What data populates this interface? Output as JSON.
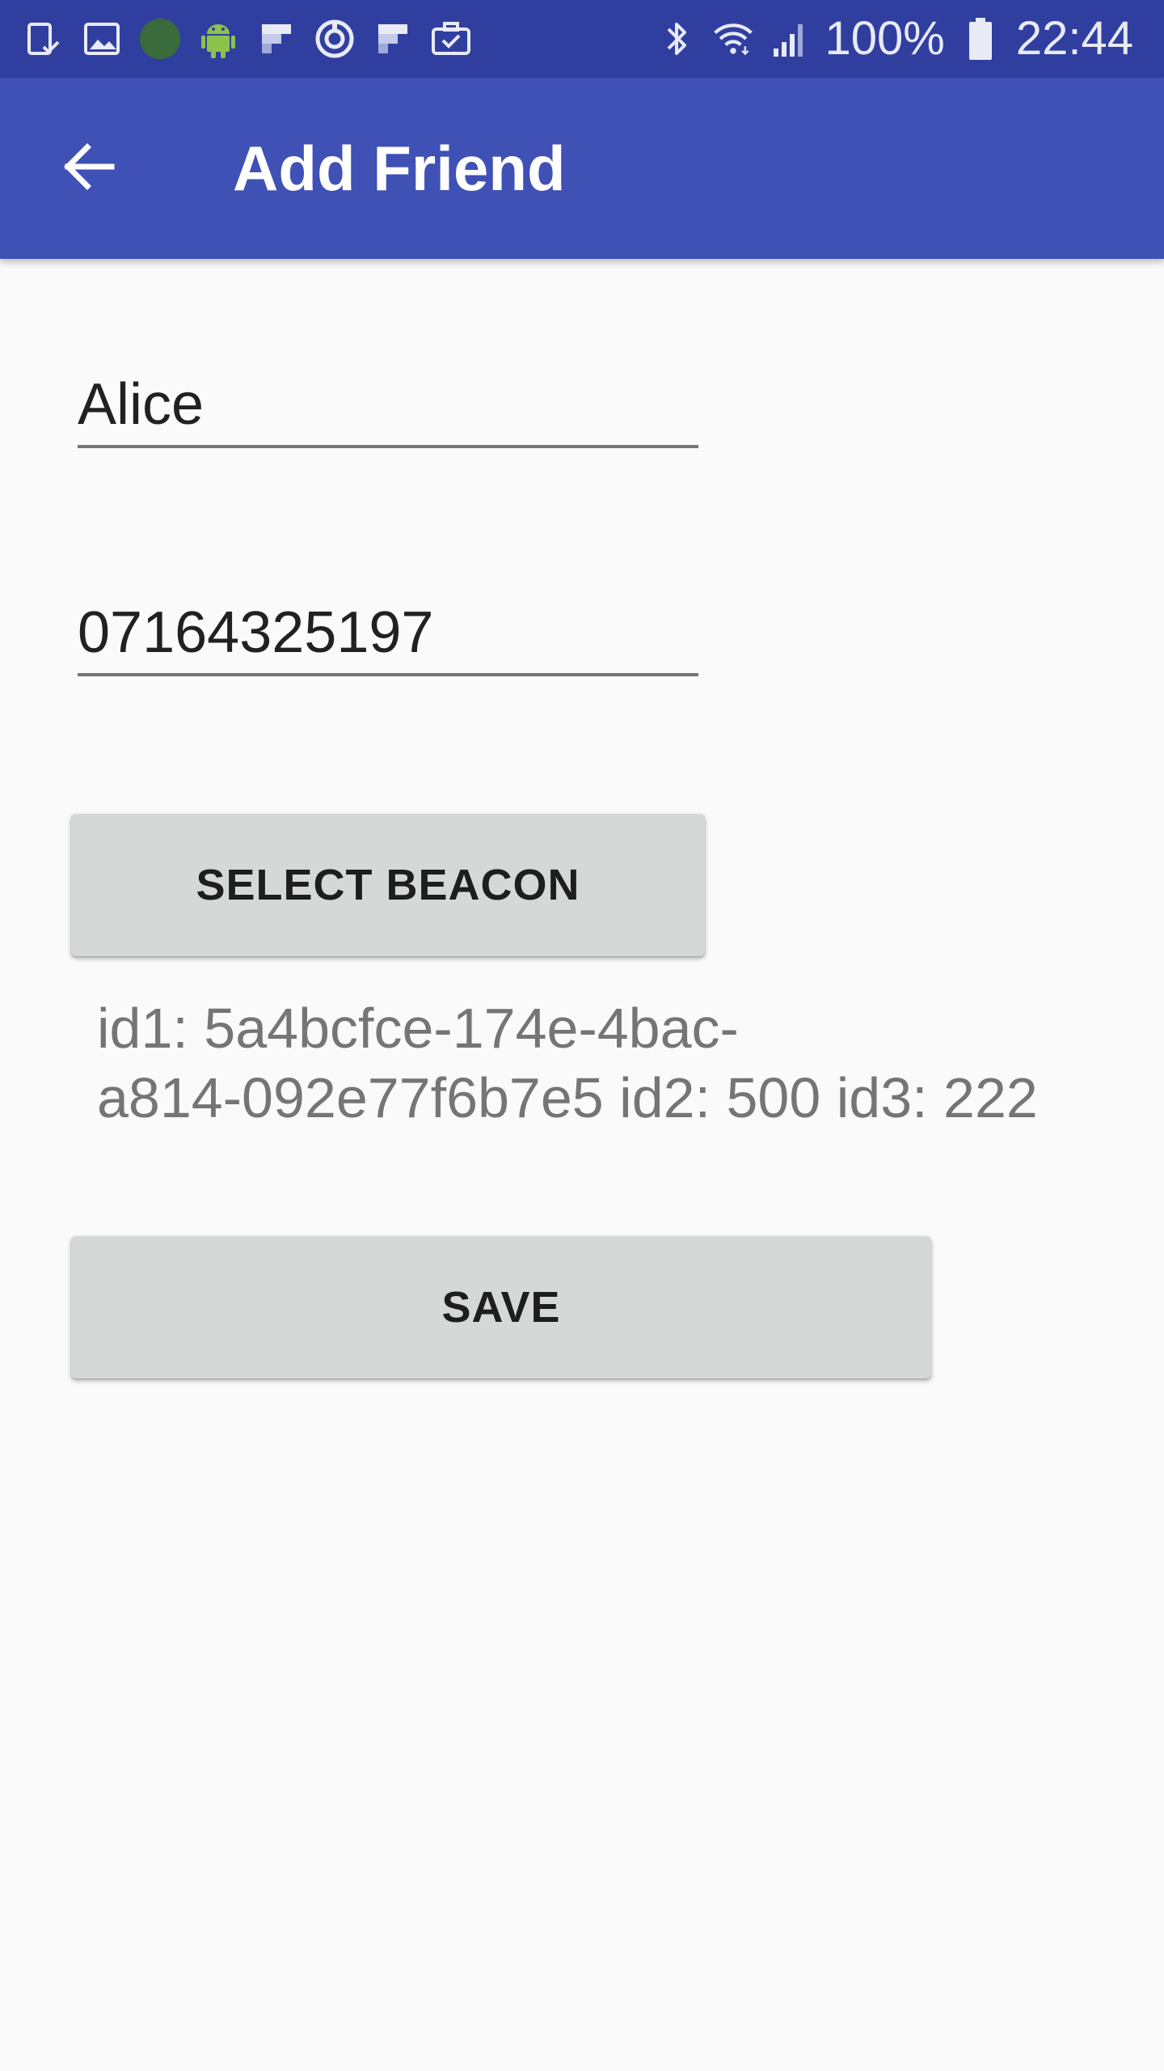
{
  "status_bar": {
    "left_icons": [
      "tablet-check-icon",
      "image-icon",
      "circle-icon",
      "android-icon",
      "flipboard-icon",
      "target-icon",
      "flipboard-icon",
      "briefcase-check-icon"
    ],
    "right_icons": [
      "bluetooth-icon",
      "wifi-icon",
      "signal-icon",
      "battery-icon"
    ],
    "battery_percent": "100%",
    "time": "22:44"
  },
  "app_bar": {
    "title": "Add Friend",
    "back_icon": "arrow-back-icon"
  },
  "form": {
    "name_value": "Alice",
    "phone_value": "07164325197",
    "select_beacon_label": "SELECT BEACON",
    "beacon_info_line1": "id1: 5a4bcfce-174e-4bac-",
    "beacon_info_line2": "a814-092e77f6b7e5 id2: 500 id3: 222",
    "save_label": "SAVE"
  },
  "colors": {
    "status_bar": "#303f9f",
    "app_bar": "#3f51b5",
    "background": "#fafafa",
    "button": "#d6d7d7",
    "secondary_text": "#757575"
  }
}
